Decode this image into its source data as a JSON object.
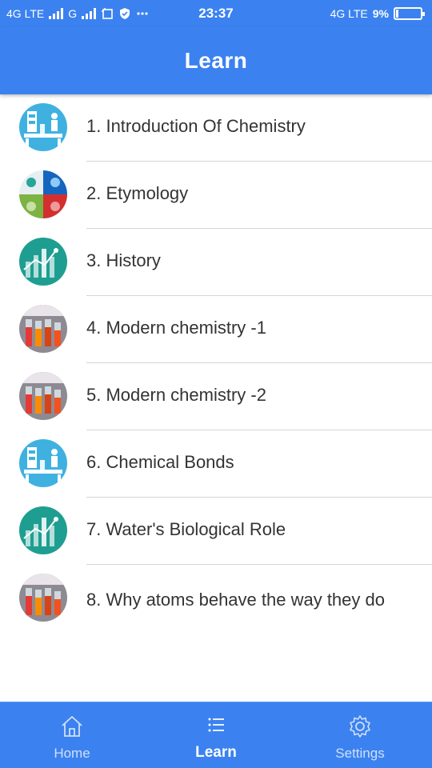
{
  "status_bar": {
    "network1": "4G LTE",
    "network2": "G",
    "time": "23:37",
    "network_right": "4G LTE",
    "battery_percent": "9%",
    "battery_level": 0.09,
    "icons": [
      "signal-icon",
      "screenshot-icon",
      "shield-icon",
      "more-dots-icon",
      "battery-icon"
    ]
  },
  "app_bar": {
    "title": "Learn"
  },
  "lessons": [
    {
      "title": "1. Introduction Of Chemistry",
      "thumb": "lab-scientist"
    },
    {
      "title": "2. Etymology",
      "thumb": "collage"
    },
    {
      "title": "3. History",
      "thumb": "history-chart"
    },
    {
      "title": "4. Modern chemistry -1",
      "thumb": "chemical-reactions"
    },
    {
      "title": "5. Modern chemistry -2",
      "thumb": "chemical-reactions"
    },
    {
      "title": "6. Chemical Bonds",
      "thumb": "lab-scientist"
    },
    {
      "title": "7. Water's Biological Role",
      "thumb": "history-chart"
    },
    {
      "title": "8. Why atoms behave the way they do",
      "thumb": "chemical-reactions"
    }
  ],
  "bottom_nav": {
    "items": [
      {
        "label": "Home",
        "icon": "home-icon",
        "active": false
      },
      {
        "label": "Learn",
        "icon": "list-icon",
        "active": true
      },
      {
        "label": "Settings",
        "icon": "gear-icon",
        "active": false
      }
    ]
  },
  "colors": {
    "primary": "#3b82f0",
    "text": "#333333",
    "divider": "#d6d6d6",
    "nav_inactive": "#cfe0fb"
  }
}
